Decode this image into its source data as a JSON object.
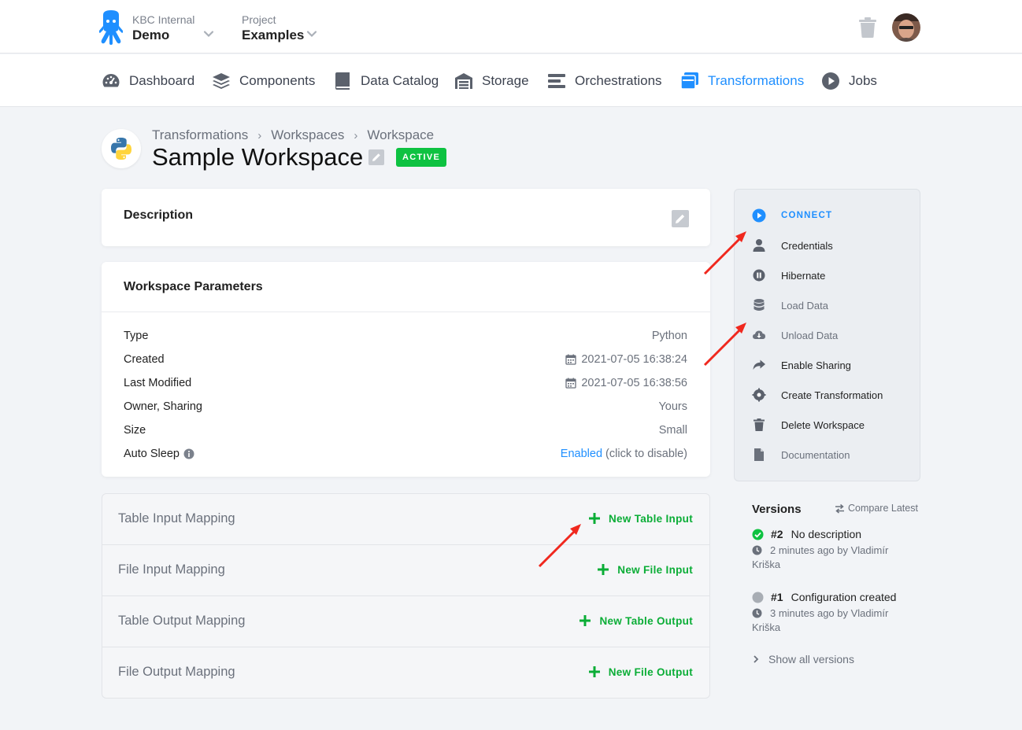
{
  "header": {
    "org_label": "KBC Internal",
    "org_name": "Demo",
    "project_label": "Project",
    "project_name": "Examples"
  },
  "nav": {
    "items": [
      {
        "label": "Dashboard",
        "icon": "dashboard-icon"
      },
      {
        "label": "Components",
        "icon": "layers-icon"
      },
      {
        "label": "Data Catalog",
        "icon": "book-icon"
      },
      {
        "label": "Storage",
        "icon": "warehouse-icon"
      },
      {
        "label": "Orchestrations",
        "icon": "bars-icon"
      },
      {
        "label": "Transformations",
        "icon": "window-icon",
        "active": true
      },
      {
        "label": "Jobs",
        "icon": "play-circle-icon"
      }
    ]
  },
  "breadcrumb": [
    "Transformations",
    "Workspaces",
    "Workspace"
  ],
  "page": {
    "title": "Sample Workspace",
    "status": "ACTIVE"
  },
  "description": {
    "heading": "Description"
  },
  "params": {
    "heading": "Workspace Parameters",
    "rows": [
      {
        "key": "Type",
        "value": "Python"
      },
      {
        "key": "Created",
        "value": "2021-07-05 16:38:24"
      },
      {
        "key": "Last Modified",
        "value": "2021-07-05 16:38:56"
      },
      {
        "key": "Owner, Sharing",
        "value": "Yours"
      },
      {
        "key": "Size",
        "value": "Small"
      },
      {
        "key": "Auto Sleep",
        "value_link": "Enabled",
        "value_rest": " (click to disable)"
      }
    ]
  },
  "mappings": [
    {
      "label": "Table Input Mapping",
      "button": "New Table Input"
    },
    {
      "label": "File Input Mapping",
      "button": "New File Input"
    },
    {
      "label": "Table Output Mapping",
      "button": "New Table Output"
    },
    {
      "label": "File Output Mapping",
      "button": "New File Output"
    }
  ],
  "sidebar": {
    "items": [
      {
        "label": "CONNECT",
        "icon": "play-circle-icon"
      },
      {
        "label": "Credentials",
        "icon": "user-icon"
      },
      {
        "label": "Hibernate",
        "icon": "pause-circle-icon"
      },
      {
        "label": "Load Data",
        "icon": "database-icon"
      },
      {
        "label": "Unload Data",
        "icon": "cloud-download-icon"
      },
      {
        "label": "Enable Sharing",
        "icon": "share-icon"
      },
      {
        "label": "Create Transformation",
        "icon": "gear-icon"
      },
      {
        "label": "Delete Workspace",
        "icon": "trash-icon"
      },
      {
        "label": "Documentation",
        "icon": "file-icon"
      }
    ]
  },
  "versions": {
    "heading": "Versions",
    "compare_label": "Compare Latest",
    "items": [
      {
        "number": "#2",
        "title": "No description",
        "meta_line1": "2 minutes ago by Vladimír",
        "meta_line2": "Kriška",
        "status": "current"
      },
      {
        "number": "#1",
        "title": "Configuration created",
        "meta_line1": "3 minutes ago by Vladimír",
        "meta_line2": "Kriška",
        "status": "previous"
      }
    ],
    "show_all": "Show all versions"
  },
  "colors": {
    "accent": "#1f8fff",
    "success": "#0ec241",
    "annotation_arrow": "#f0281e"
  }
}
